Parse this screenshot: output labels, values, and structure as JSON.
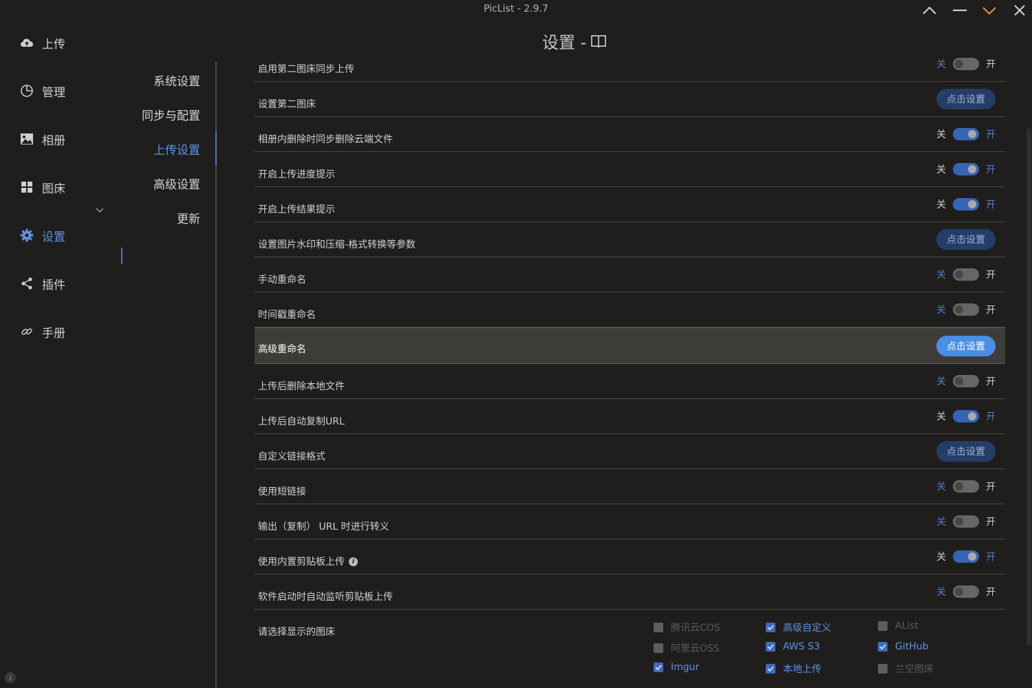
{
  "window": {
    "title": "PicList - 2.9.7"
  },
  "nav": {
    "items": [
      {
        "label": "上传",
        "icon": "cloud-upload-icon"
      },
      {
        "label": "管理",
        "icon": "pie-chart-icon"
      },
      {
        "label": "相册",
        "icon": "picture-icon"
      },
      {
        "label": "图床",
        "icon": "grid-icon"
      },
      {
        "label": "设置",
        "icon": "gear-icon",
        "active": true
      },
      {
        "label": "插件",
        "icon": "share-icon"
      },
      {
        "label": "手册",
        "icon": "link-icon"
      }
    ]
  },
  "subnav": {
    "items": [
      {
        "label": "系统设置"
      },
      {
        "label": "同步与配置"
      },
      {
        "label": "上传设置",
        "active": true
      },
      {
        "label": "高级设置"
      },
      {
        "label": "更新"
      }
    ]
  },
  "page": {
    "title": "设置 -"
  },
  "switch": {
    "off": "关",
    "on": "开"
  },
  "rows": [
    {
      "label": "启用第二图床同步上传",
      "type": "switch",
      "value": false
    },
    {
      "label": "设置第二图床",
      "type": "button",
      "button": "点击设置"
    },
    {
      "label": "相册内删除时同步删除云端文件",
      "type": "switch",
      "value": true
    },
    {
      "label": "开启上传进度提示",
      "type": "switch",
      "value": true
    },
    {
      "label": "开启上传结果提示",
      "type": "switch",
      "value": true
    },
    {
      "label": "设置图片水印和压缩-格式转换等参数",
      "type": "button",
      "button": "点击设置"
    },
    {
      "label": "手动重命名",
      "type": "switch",
      "value": false
    },
    {
      "label": "时间戳重命名",
      "type": "switch",
      "value": false
    },
    {
      "label": "高级重命名",
      "type": "button",
      "button": "点击设置",
      "highlight": true
    },
    {
      "label": "上传后删除本地文件",
      "type": "switch",
      "value": false
    },
    {
      "label": "上传后自动复制URL",
      "type": "switch",
      "value": true
    },
    {
      "label": "自定义链接格式",
      "type": "button",
      "button": "点击设置"
    },
    {
      "label": "使用短链接",
      "type": "switch",
      "value": false
    },
    {
      "label": "输出（复制） URL 时进行转义",
      "type": "switch",
      "value": false
    },
    {
      "label": "使用内置剪贴板上传",
      "type": "switch",
      "value": true,
      "info": true
    },
    {
      "label": "软件启动时自动监听剪贴板上传",
      "type": "switch",
      "value": false
    }
  ],
  "picbeds": {
    "label": "请选择显示的图床",
    "items": [
      {
        "name": "腾讯云COS",
        "checked": false
      },
      {
        "name": "高级自定义",
        "checked": true
      },
      {
        "name": "AList",
        "checked": false
      },
      {
        "name": "阿里云OSS",
        "checked": false
      },
      {
        "name": "AWS S3",
        "checked": true
      },
      {
        "name": "GitHub",
        "checked": true
      },
      {
        "name": "Imgur",
        "checked": true
      },
      {
        "name": "本地上传",
        "checked": true
      },
      {
        "name": "兰空图床",
        "checked": false
      }
    ]
  }
}
